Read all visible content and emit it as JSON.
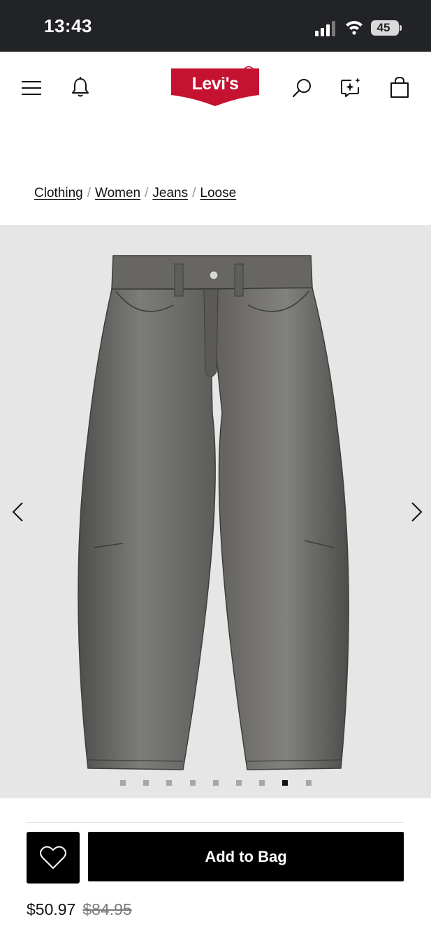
{
  "status_bar": {
    "time": "13:43",
    "battery": "45"
  },
  "nav": {
    "brand": "Levi's",
    "icons": [
      "menu-icon",
      "bell-icon",
      "search-icon",
      "sparkle-chat-icon",
      "shopping-bag-icon"
    ]
  },
  "breadcrumb": {
    "items": [
      "Clothing",
      "Women",
      "Jeans",
      "Loose"
    ],
    "separator": "/"
  },
  "gallery": {
    "image_count": 9,
    "active_index": 7,
    "background": "#e6e6e6"
  },
  "actions": {
    "add_to_bag_label": "Add to Bag",
    "favorite_icon": "heart-icon"
  },
  "price": {
    "sale": "$50.97",
    "original": "$84.95"
  },
  "colors": {
    "brand_red": "#c41230",
    "button_black": "#000000",
    "status_bar": "#222326"
  }
}
